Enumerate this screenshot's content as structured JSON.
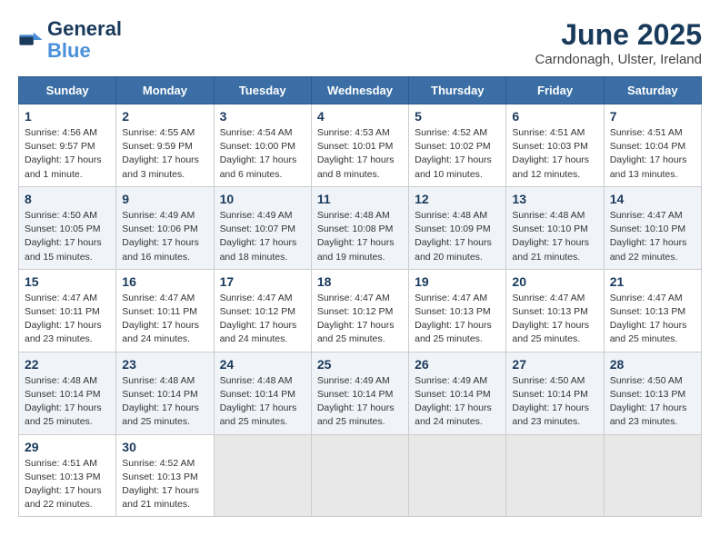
{
  "header": {
    "logo_line1": "General",
    "logo_line2": "Blue",
    "month": "June 2025",
    "location": "Carndonagh, Ulster, Ireland"
  },
  "days_of_week": [
    "Sunday",
    "Monday",
    "Tuesday",
    "Wednesday",
    "Thursday",
    "Friday",
    "Saturday"
  ],
  "weeks": [
    [
      {
        "day": "1",
        "sunrise": "Sunrise: 4:56 AM",
        "sunset": "Sunset: 9:57 PM",
        "daylight": "Daylight: 17 hours and 1 minute."
      },
      {
        "day": "2",
        "sunrise": "Sunrise: 4:55 AM",
        "sunset": "Sunset: 9:59 PM",
        "daylight": "Daylight: 17 hours and 3 minutes."
      },
      {
        "day": "3",
        "sunrise": "Sunrise: 4:54 AM",
        "sunset": "Sunset: 10:00 PM",
        "daylight": "Daylight: 17 hours and 6 minutes."
      },
      {
        "day": "4",
        "sunrise": "Sunrise: 4:53 AM",
        "sunset": "Sunset: 10:01 PM",
        "daylight": "Daylight: 17 hours and 8 minutes."
      },
      {
        "day": "5",
        "sunrise": "Sunrise: 4:52 AM",
        "sunset": "Sunset: 10:02 PM",
        "daylight": "Daylight: 17 hours and 10 minutes."
      },
      {
        "day": "6",
        "sunrise": "Sunrise: 4:51 AM",
        "sunset": "Sunset: 10:03 PM",
        "daylight": "Daylight: 17 hours and 12 minutes."
      },
      {
        "day": "7",
        "sunrise": "Sunrise: 4:51 AM",
        "sunset": "Sunset: 10:04 PM",
        "daylight": "Daylight: 17 hours and 13 minutes."
      }
    ],
    [
      {
        "day": "8",
        "sunrise": "Sunrise: 4:50 AM",
        "sunset": "Sunset: 10:05 PM",
        "daylight": "Daylight: 17 hours and 15 minutes."
      },
      {
        "day": "9",
        "sunrise": "Sunrise: 4:49 AM",
        "sunset": "Sunset: 10:06 PM",
        "daylight": "Daylight: 17 hours and 16 minutes."
      },
      {
        "day": "10",
        "sunrise": "Sunrise: 4:49 AM",
        "sunset": "Sunset: 10:07 PM",
        "daylight": "Daylight: 17 hours and 18 minutes."
      },
      {
        "day": "11",
        "sunrise": "Sunrise: 4:48 AM",
        "sunset": "Sunset: 10:08 PM",
        "daylight": "Daylight: 17 hours and 19 minutes."
      },
      {
        "day": "12",
        "sunrise": "Sunrise: 4:48 AM",
        "sunset": "Sunset: 10:09 PM",
        "daylight": "Daylight: 17 hours and 20 minutes."
      },
      {
        "day": "13",
        "sunrise": "Sunrise: 4:48 AM",
        "sunset": "Sunset: 10:10 PM",
        "daylight": "Daylight: 17 hours and 21 minutes."
      },
      {
        "day": "14",
        "sunrise": "Sunrise: 4:47 AM",
        "sunset": "Sunset: 10:10 PM",
        "daylight": "Daylight: 17 hours and 22 minutes."
      }
    ],
    [
      {
        "day": "15",
        "sunrise": "Sunrise: 4:47 AM",
        "sunset": "Sunset: 10:11 PM",
        "daylight": "Daylight: 17 hours and 23 minutes."
      },
      {
        "day": "16",
        "sunrise": "Sunrise: 4:47 AM",
        "sunset": "Sunset: 10:11 PM",
        "daylight": "Daylight: 17 hours and 24 minutes."
      },
      {
        "day": "17",
        "sunrise": "Sunrise: 4:47 AM",
        "sunset": "Sunset: 10:12 PM",
        "daylight": "Daylight: 17 hours and 24 minutes."
      },
      {
        "day": "18",
        "sunrise": "Sunrise: 4:47 AM",
        "sunset": "Sunset: 10:12 PM",
        "daylight": "Daylight: 17 hours and 25 minutes."
      },
      {
        "day": "19",
        "sunrise": "Sunrise: 4:47 AM",
        "sunset": "Sunset: 10:13 PM",
        "daylight": "Daylight: 17 hours and 25 minutes."
      },
      {
        "day": "20",
        "sunrise": "Sunrise: 4:47 AM",
        "sunset": "Sunset: 10:13 PM",
        "daylight": "Daylight: 17 hours and 25 minutes."
      },
      {
        "day": "21",
        "sunrise": "Sunrise: 4:47 AM",
        "sunset": "Sunset: 10:13 PM",
        "daylight": "Daylight: 17 hours and 25 minutes."
      }
    ],
    [
      {
        "day": "22",
        "sunrise": "Sunrise: 4:48 AM",
        "sunset": "Sunset: 10:14 PM",
        "daylight": "Daylight: 17 hours and 25 minutes."
      },
      {
        "day": "23",
        "sunrise": "Sunrise: 4:48 AM",
        "sunset": "Sunset: 10:14 PM",
        "daylight": "Daylight: 17 hours and 25 minutes."
      },
      {
        "day": "24",
        "sunrise": "Sunrise: 4:48 AM",
        "sunset": "Sunset: 10:14 PM",
        "daylight": "Daylight: 17 hours and 25 minutes."
      },
      {
        "day": "25",
        "sunrise": "Sunrise: 4:49 AM",
        "sunset": "Sunset: 10:14 PM",
        "daylight": "Daylight: 17 hours and 25 minutes."
      },
      {
        "day": "26",
        "sunrise": "Sunrise: 4:49 AM",
        "sunset": "Sunset: 10:14 PM",
        "daylight": "Daylight: 17 hours and 24 minutes."
      },
      {
        "day": "27",
        "sunrise": "Sunrise: 4:50 AM",
        "sunset": "Sunset: 10:14 PM",
        "daylight": "Daylight: 17 hours and 23 minutes."
      },
      {
        "day": "28",
        "sunrise": "Sunrise: 4:50 AM",
        "sunset": "Sunset: 10:13 PM",
        "daylight": "Daylight: 17 hours and 23 minutes."
      }
    ],
    [
      {
        "day": "29",
        "sunrise": "Sunrise: 4:51 AM",
        "sunset": "Sunset: 10:13 PM",
        "daylight": "Daylight: 17 hours and 22 minutes."
      },
      {
        "day": "30",
        "sunrise": "Sunrise: 4:52 AM",
        "sunset": "Sunset: 10:13 PM",
        "daylight": "Daylight: 17 hours and 21 minutes."
      },
      null,
      null,
      null,
      null,
      null
    ]
  ]
}
